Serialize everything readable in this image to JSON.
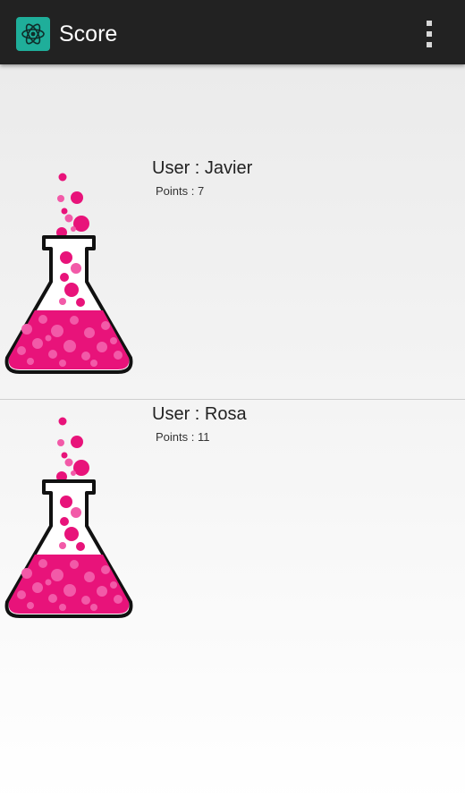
{
  "app_bar": {
    "title": "Score",
    "app_icon": "atom-icon",
    "menu_icon": "overflow-menu-icon",
    "background_color": "#222222",
    "icon_color": "#1fae9a"
  },
  "scores": [
    {
      "user_label": "User : Javier",
      "points_label": "Points : 7",
      "image": "pink-bubbling-flask"
    },
    {
      "user_label": "User : Rosa",
      "points_label": "Points : 11",
      "image": "pink-bubbling-flask"
    }
  ],
  "colors": {
    "flask_liquid": "#e8137a",
    "flask_bubbles": "#f25aa8"
  }
}
